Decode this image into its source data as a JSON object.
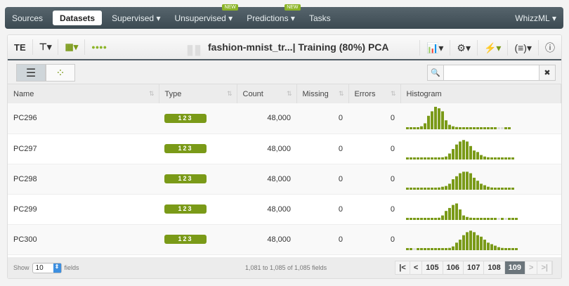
{
  "nav": {
    "items": [
      "Sources",
      "Datasets",
      "Supervised",
      "Unsupervised",
      "Predictions",
      "Tasks"
    ],
    "new_badge": "NEW",
    "right": "WhizzML"
  },
  "toolbar": {
    "abbr": "TE",
    "title": "fashion-mnist_tr...| Training (80%) PCA"
  },
  "table": {
    "headers": [
      "Name",
      "Type",
      "Count",
      "Missing",
      "Errors",
      "Histogram"
    ],
    "rows": [
      {
        "name": "PC296",
        "type": "123",
        "count": "48,000",
        "missing": "0",
        "errors": "0",
        "hist": [
          1,
          1,
          1,
          1,
          2,
          4,
          9,
          12,
          15,
          14,
          12,
          6,
          3,
          2,
          1.5,
          1,
          1,
          1,
          1,
          1,
          1,
          1,
          1,
          1,
          1,
          1,
          0,
          0,
          1,
          1
        ]
      },
      {
        "name": "PC297",
        "type": "123",
        "count": "48,000",
        "missing": "0",
        "errors": "0",
        "hist": [
          1,
          1,
          1,
          1,
          1,
          1,
          1,
          1,
          1,
          1,
          1.5,
          2,
          4,
          7,
          10,
          12,
          13,
          12,
          9,
          6,
          5,
          3,
          2,
          1.5,
          1,
          1,
          1,
          1,
          1,
          1,
          1
        ]
      },
      {
        "name": "PC298",
        "type": "123",
        "count": "48,000",
        "missing": "0",
        "errors": "0",
        "hist": [
          1,
          1,
          1,
          1,
          1,
          1,
          1,
          1,
          1,
          1.5,
          2,
          2.5,
          4,
          7,
          9,
          11,
          12,
          12,
          11,
          8,
          6,
          4,
          3,
          2,
          1.5,
          1,
          1,
          1,
          1,
          1,
          1
        ]
      },
      {
        "name": "PC299",
        "type": "123",
        "count": "48,000",
        "missing": "0",
        "errors": "0",
        "hist": [
          1,
          1,
          1,
          1,
          1,
          1,
          1,
          1,
          1,
          1.5,
          3,
          6,
          8,
          10,
          11,
          7,
          3,
          2,
          1.5,
          1.2,
          1,
          1,
          1,
          1,
          1,
          1,
          0,
          1,
          0,
          1,
          1,
          1
        ]
      },
      {
        "name": "PC300",
        "type": "123",
        "count": "48,000",
        "missing": "0",
        "errors": "0",
        "hist": [
          1,
          1,
          0,
          1,
          1,
          1,
          1,
          1,
          1,
          1,
          1,
          1,
          1.5,
          2.5,
          5,
          7,
          10,
          12,
          13,
          12,
          10,
          9,
          7,
          5,
          4,
          3,
          2,
          1.5,
          1,
          1,
          1,
          1,
          1
        ]
      }
    ]
  },
  "footer": {
    "show": "Show",
    "page_size": "10",
    "fields": "fields",
    "range": "1,081 to 1,085 of 1,085 fields",
    "pages": [
      "105",
      "106",
      "107",
      "108",
      "109"
    ],
    "current": "109"
  },
  "colors": {
    "accent": "#7a9a18"
  }
}
